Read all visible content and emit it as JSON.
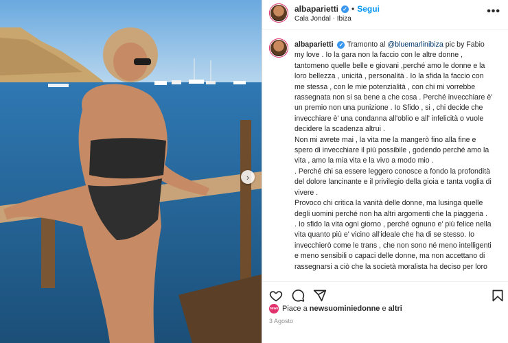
{
  "post": {
    "username": "albaparietti",
    "follow_label": "Segui",
    "separator": "•",
    "location": "Cala Jondal · Ibiza",
    "more_icon": "•••"
  },
  "caption": {
    "username": "albaparietti",
    "text_intro": "Tramonto al ",
    "mention": "@bluemarlinibiza",
    "text_after_mention": " pic by Fabio my love . Io la gara non la faccio con le altre donne , tantomeno quelle belle e giovani ,perché amo le donne e la loro bellezza , unicità , personalità . Io la sfida la faccio con me stessa , con le mie potenzialità , con chi mi vorrebbe rassegnata non si sa bene a che cosa . Perché invecchiare è' un premio non una punizione . Io Sfido , si , chi decide che invecchiare è' una condanna all'oblio e all' infelicità o vuole decidere la scadenza altrui .",
    "paragraph_2": "Non mi avrete mai , la vita me la mangerò fino alla fine e spero di invecchiare il più possibile , godendo perché amo la vita , amo la mia vita e la vivo a modo mio .",
    "paragraph_3": ". Perché chi sa essere leggero conosce a fondo la profondità del dolore lancinante e il privilegio della gioia e tanta voglia di vivere .",
    "paragraph_4": "Provoco chi critica la vanità delle donne, ma lusinga quelle degli uomini perché non ha altri argomenti che la piaggeria .",
    "paragraph_5": ". Io sfido la vita ogni giorno , perché ognuno e' più felice nella vita quanto più e' vicino all'ideale che ha di se stesso. Io invecchierò come le trans , che non sono né meno intelligenti e meno sensibili o capaci delle donne, ma non accettano di rassegnarsi a ciò che la società moralista ha deciso per loro ....",
    "heart": "♥"
  },
  "likes": {
    "prefix": "Piace a ",
    "user": "newsuominiedonne",
    "conjunction": " e ",
    "others": "altri",
    "avatar_text": "news"
  },
  "date": "3 Agosto",
  "icons": {
    "like": "heart-icon",
    "comment": "comment-icon",
    "share": "share-icon",
    "save": "bookmark-icon",
    "next": "chevron-right-icon"
  },
  "colors": {
    "accent": "#0095f6",
    "verified": "#3897f0",
    "mention": "#00376b"
  }
}
